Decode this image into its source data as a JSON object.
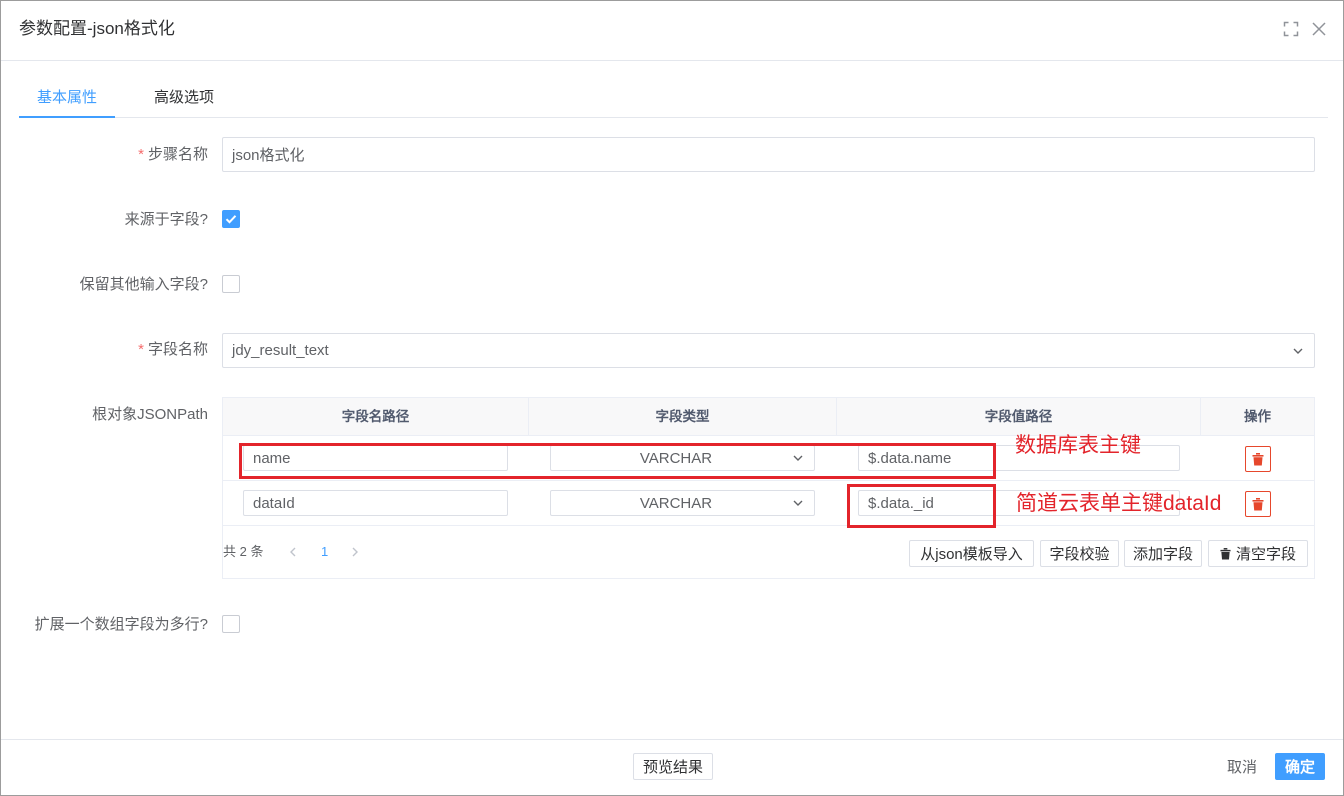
{
  "dialog": {
    "title": "参数配置-json格式化"
  },
  "tabs": [
    {
      "label": "基本属性",
      "active": true
    },
    {
      "label": "高级选项",
      "active": false
    }
  ],
  "form": {
    "required_mark": "*",
    "step_name": {
      "label": "步骤名称",
      "required": true,
      "value": "json格式化"
    },
    "from_field": {
      "label": "来源于字段?",
      "checked": true
    },
    "keep_other_fields": {
      "label": "保留其他输入字段?",
      "checked": false
    },
    "field_name": {
      "label": "字段名称",
      "required": true,
      "value": "jdy_result_text"
    },
    "root_jsonpath": {
      "label": "根对象JSONPath"
    },
    "expand_array_field": {
      "label": "扩展一个数组字段为多行?",
      "checked": false
    }
  },
  "table": {
    "columns": [
      "字段名路径",
      "字段类型",
      "字段值路径",
      "操作"
    ],
    "rows": [
      {
        "name_path": "name",
        "type": "VARCHAR",
        "value_path": "$.data.name"
      },
      {
        "name_path": "dataId",
        "type": "VARCHAR",
        "value_path": "$.data._id"
      }
    ],
    "pagination": {
      "total": "共 2 条",
      "current_page": "1"
    },
    "actions": {
      "import_json": "从json模板导入",
      "validate": "字段校验",
      "add_field": "添加字段",
      "clear_fields": "清空字段"
    }
  },
  "annotations": [
    {
      "text": "数据库表主键"
    },
    {
      "text": "简道云表单主键dataId"
    }
  ],
  "footer": {
    "preview": "预览结果",
    "cancel": "取消",
    "confirm": "确定"
  },
  "colors": {
    "primary": "#409eff",
    "annot": "#e3242b",
    "danger": "#e6472c",
    "required": "#f56c6c"
  },
  "icons": {
    "header": [
      "fullscreen-icon",
      "close-icon"
    ],
    "select": "chevron-down-icon",
    "checkbox": "check-icon",
    "row_delete": "trash-icon",
    "clear_fields": "trash-icon",
    "pagination": [
      "chevron-left-icon",
      "chevron-right-icon"
    ]
  }
}
